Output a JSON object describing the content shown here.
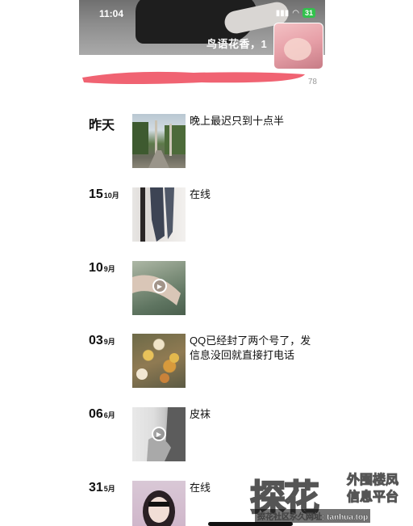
{
  "status": {
    "time": "11:04",
    "battery": "31"
  },
  "profile": {
    "nickname": "鸟语花香，1",
    "count_fragment": "78"
  },
  "posts": [
    {
      "day": "昨天",
      "month": "",
      "caption": "晚上最迟只到十点半",
      "video": false
    },
    {
      "day": "15",
      "month": "10月",
      "caption": "在线",
      "video": false
    },
    {
      "day": "10",
      "month": "9月",
      "caption": "",
      "video": true
    },
    {
      "day": "03",
      "month": "9月",
      "caption": "QQ已经封了两个号了，发信息没回就直接打电话",
      "video": false
    },
    {
      "day": "06",
      "month": "6月",
      "caption": "皮袜",
      "video": true
    },
    {
      "day": "31",
      "month": "5月",
      "caption": "在线",
      "video": false
    }
  ],
  "watermark": {
    "logo": "探花",
    "line1": "外围楼凤",
    "line2": "信息平台",
    "url": "探花社区永久网址: tanhua.top"
  }
}
